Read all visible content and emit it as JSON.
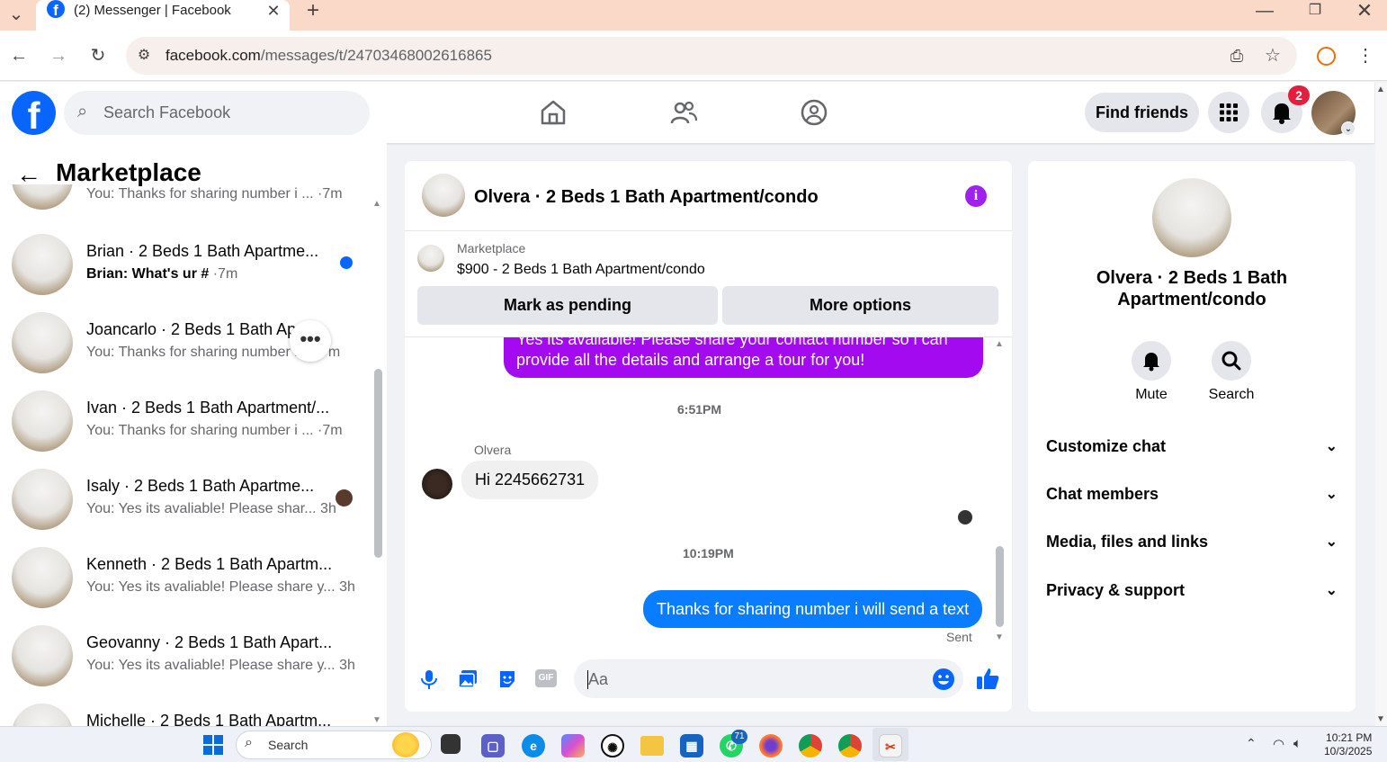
{
  "browser": {
    "tab_title": "(2) Messenger | Facebook",
    "url_host": "facebook.com",
    "url_path": "/messages/t/24703468002616865"
  },
  "fb_header": {
    "search_placeholder": "Search Facebook",
    "find_friends_label": "Find friends",
    "notification_count": "2"
  },
  "sidebar": {
    "title": "Marketplace",
    "partial_preview": "You: Thanks for sharing number i ...   ·7m",
    "conversations": [
      {
        "name": "Brian · 2 Beds 1 Bath Apartme...",
        "preview": "Brian: What's ur #",
        "time": "·7m",
        "unread": true
      },
      {
        "name": "Joancarlo · 2 Beds 1 Bath Apa",
        "preview": "You: Thanks for sharing number i",
        "time": "m"
      },
      {
        "name": "Ivan · 2 Beds 1 Bath Apartment/...",
        "preview": "You: Thanks for sharing number i ...",
        "time": "·7m"
      },
      {
        "name": "Isaly · 2 Beds 1 Bath Apartme...",
        "preview": "You: Yes its avaliable! Please shar...",
        "time": "3h"
      },
      {
        "name": "Kenneth · 2 Beds 1 Bath Apartm...",
        "preview": "You: Yes its avaliable! Please share y...",
        "time": "3h"
      },
      {
        "name": "Geovanny · 2 Beds 1 Bath Apart...",
        "preview": "You: Yes its avaliable! Please share y...",
        "time": "3h"
      },
      {
        "name": "Michelle · 2 Beds 1 Bath Apartm...",
        "preview": "",
        "time": ""
      }
    ]
  },
  "chat": {
    "title": "Olvera · 2 Beds 1 Bath Apartment/condo",
    "marketplace_label": "Marketplace",
    "listing": "$900 - 2 Beds 1 Bath Apartment/condo",
    "mark_pending_label": "Mark as pending",
    "more_options_label": "More options",
    "messages": {
      "outgoing_1": "Yes its avaliable! Please share your contact number so i can provide all the details and arrange a tour for you!",
      "time_1": "6:51PM",
      "sender_name": "Olvera",
      "incoming_1": "Hi 2245662731",
      "time_2": "10:19PM",
      "outgoing_2": "Thanks for sharing number i will send a text",
      "status": "Sent"
    },
    "composer_placeholder": "Aa"
  },
  "info_panel": {
    "name": "Olvera · 2 Beds 1 Bath Apartment/condo",
    "mute_label": "Mute",
    "search_label": "Search",
    "sections": [
      "Customize chat",
      "Chat members",
      "Media, files and links",
      "Privacy & support"
    ]
  },
  "taskbar": {
    "search_label": "Search",
    "whatsapp_badge": "71",
    "time": "10:21 PM",
    "date": "10/3/2025"
  }
}
